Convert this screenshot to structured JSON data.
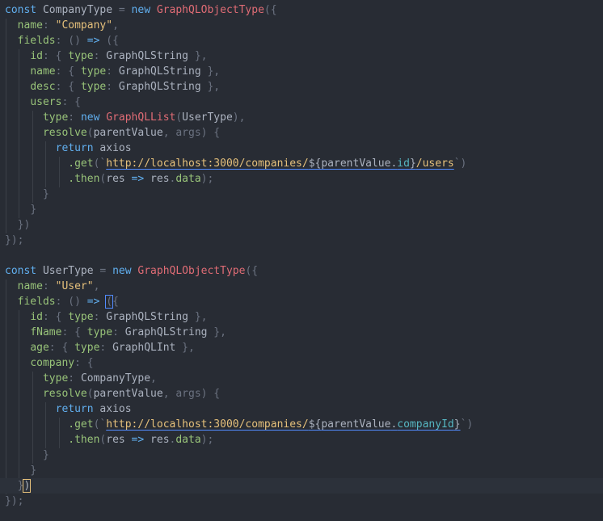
{
  "editor": {
    "lines": [
      [
        {
          "t": "const ",
          "c": "kw2"
        },
        {
          "t": "CompanyType",
          "c": "var"
        },
        {
          "t": " = ",
          "c": "punc"
        },
        {
          "t": "new ",
          "c": "kw2"
        },
        {
          "t": "GraphQLObjectType",
          "c": "class"
        },
        {
          "t": "({",
          "c": "punc"
        }
      ],
      [
        {
          "t": "  "
        },
        {
          "t": "name",
          "c": "prop"
        },
        {
          "t": ": ",
          "c": "punc"
        },
        {
          "t": "\"Company\"",
          "c": "str"
        },
        {
          "t": ",",
          "c": "punc"
        }
      ],
      [
        {
          "t": "  "
        },
        {
          "t": "fields",
          "c": "prop"
        },
        {
          "t": ": () ",
          "c": "punc"
        },
        {
          "t": "=>",
          "c": "kw2"
        },
        {
          "t": " ({",
          "c": "punc"
        }
      ],
      [
        {
          "t": "    "
        },
        {
          "t": "id",
          "c": "prop"
        },
        {
          "t": ": { ",
          "c": "punc"
        },
        {
          "t": "type",
          "c": "prop"
        },
        {
          "t": ": ",
          "c": "punc"
        },
        {
          "t": "GraphQLString",
          "c": "var"
        },
        {
          "t": " },",
          "c": "punc"
        }
      ],
      [
        {
          "t": "    "
        },
        {
          "t": "name",
          "c": "prop"
        },
        {
          "t": ": { ",
          "c": "punc"
        },
        {
          "t": "type",
          "c": "prop"
        },
        {
          "t": ": ",
          "c": "punc"
        },
        {
          "t": "GraphQLString",
          "c": "var"
        },
        {
          "t": " },",
          "c": "punc"
        }
      ],
      [
        {
          "t": "    "
        },
        {
          "t": "desc",
          "c": "prop"
        },
        {
          "t": ": { ",
          "c": "punc"
        },
        {
          "t": "type",
          "c": "prop"
        },
        {
          "t": ": ",
          "c": "punc"
        },
        {
          "t": "GraphQLString",
          "c": "var"
        },
        {
          "t": " },",
          "c": "punc"
        }
      ],
      [
        {
          "t": "    "
        },
        {
          "t": "users",
          "c": "prop"
        },
        {
          "t": ": {",
          "c": "punc"
        }
      ],
      [
        {
          "t": "      "
        },
        {
          "t": "type",
          "c": "prop"
        },
        {
          "t": ": ",
          "c": "punc"
        },
        {
          "t": "new ",
          "c": "kw2"
        },
        {
          "t": "GraphQLList",
          "c": "class"
        },
        {
          "t": "(",
          "c": "punc"
        },
        {
          "t": "UserType",
          "c": "var"
        },
        {
          "t": "),",
          "c": "punc"
        }
      ],
      [
        {
          "t": "      "
        },
        {
          "t": "resolve",
          "c": "fn"
        },
        {
          "t": "(",
          "c": "punc"
        },
        {
          "t": "parentValue",
          "c": "param"
        },
        {
          "t": ", ",
          "c": "punc"
        },
        {
          "t": "args",
          "c": "punc"
        },
        {
          "t": ") {",
          "c": "punc"
        }
      ],
      [
        {
          "t": "        "
        },
        {
          "t": "return ",
          "c": "kw2"
        },
        {
          "t": "axios",
          "c": "var"
        }
      ],
      [
        {
          "t": "          "
        },
        {
          "t": ".get",
          "c": "fn"
        },
        {
          "t": "(`",
          "c": "punc"
        },
        {
          "t": "http://localhost:3000/companies/",
          "c": "url"
        },
        {
          "t": "${",
          "c": "tmpl"
        },
        {
          "t": "parentValue",
          "c": "tmpl"
        },
        {
          "t": ".",
          "c": "tmpl"
        },
        {
          "t": "id",
          "c": "mem"
        },
        {
          "t": "}",
          "c": "tmpl"
        },
        {
          "t": "/users",
          "c": "url"
        },
        {
          "t": "`)",
          "c": "punc"
        }
      ],
      [
        {
          "t": "          "
        },
        {
          "t": ".then",
          "c": "fn"
        },
        {
          "t": "(",
          "c": "punc"
        },
        {
          "t": "res",
          "c": "param"
        },
        {
          "t": " => ",
          "c": "kw2"
        },
        {
          "t": "res",
          "c": "var"
        },
        {
          "t": ".",
          "c": "punc"
        },
        {
          "t": "data",
          "c": "prop"
        },
        {
          "t": ");",
          "c": "punc"
        }
      ],
      [
        {
          "t": "      "
        },
        {
          "t": "}",
          "c": "punc"
        }
      ],
      [
        {
          "t": "    "
        },
        {
          "t": "}",
          "c": "punc"
        }
      ],
      [
        {
          "t": "  "
        },
        {
          "t": "})",
          "c": "punc"
        }
      ],
      [
        {
          "t": "});",
          "c": "punc"
        }
      ],
      [],
      [
        {
          "t": "const ",
          "c": "kw2"
        },
        {
          "t": "UserType",
          "c": "var"
        },
        {
          "t": " = ",
          "c": "punc"
        },
        {
          "t": "new ",
          "c": "kw2"
        },
        {
          "t": "GraphQLObjectType",
          "c": "class"
        },
        {
          "t": "({",
          "c": "punc"
        }
      ],
      [
        {
          "t": "  "
        },
        {
          "t": "name",
          "c": "prop"
        },
        {
          "t": ": ",
          "c": "punc"
        },
        {
          "t": "\"User\"",
          "c": "str"
        },
        {
          "t": ",",
          "c": "punc"
        }
      ],
      [
        {
          "t": "  "
        },
        {
          "t": "fields",
          "c": "prop"
        },
        {
          "t": ": () ",
          "c": "punc"
        },
        {
          "t": "=>",
          "c": "kw2"
        },
        {
          "t": " ",
          "c": "punc"
        },
        {
          "t": "(",
          "c": "bm"
        },
        {
          "t": "{",
          "c": "punc"
        }
      ],
      [
        {
          "t": "    "
        },
        {
          "t": "id",
          "c": "prop"
        },
        {
          "t": ": { ",
          "c": "punc"
        },
        {
          "t": "type",
          "c": "prop"
        },
        {
          "t": ": ",
          "c": "punc"
        },
        {
          "t": "GraphQLString",
          "c": "var"
        },
        {
          "t": " },",
          "c": "punc"
        }
      ],
      [
        {
          "t": "    "
        },
        {
          "t": "fName",
          "c": "prop"
        },
        {
          "t": ": { ",
          "c": "punc"
        },
        {
          "t": "type",
          "c": "prop"
        },
        {
          "t": ": ",
          "c": "punc"
        },
        {
          "t": "GraphQLString",
          "c": "var"
        },
        {
          "t": " },",
          "c": "punc"
        }
      ],
      [
        {
          "t": "    "
        },
        {
          "t": "age",
          "c": "prop"
        },
        {
          "t": ": { ",
          "c": "punc"
        },
        {
          "t": "type",
          "c": "prop"
        },
        {
          "t": ": ",
          "c": "punc"
        },
        {
          "t": "GraphQLInt",
          "c": "var"
        },
        {
          "t": " },",
          "c": "punc"
        }
      ],
      [
        {
          "t": "    "
        },
        {
          "t": "company",
          "c": "prop"
        },
        {
          "t": ": {",
          "c": "punc"
        }
      ],
      [
        {
          "t": "      "
        },
        {
          "t": "type",
          "c": "prop"
        },
        {
          "t": ": ",
          "c": "punc"
        },
        {
          "t": "CompanyType",
          "c": "var"
        },
        {
          "t": ",",
          "c": "punc"
        }
      ],
      [
        {
          "t": "      "
        },
        {
          "t": "resolve",
          "c": "fn"
        },
        {
          "t": "(",
          "c": "punc"
        },
        {
          "t": "parentValue",
          "c": "param"
        },
        {
          "t": ", ",
          "c": "punc"
        },
        {
          "t": "args",
          "c": "punc"
        },
        {
          "t": ") {",
          "c": "punc"
        }
      ],
      [
        {
          "t": "        "
        },
        {
          "t": "return ",
          "c": "kw2"
        },
        {
          "t": "axios",
          "c": "var"
        }
      ],
      [
        {
          "t": "          "
        },
        {
          "t": ".get",
          "c": "fn"
        },
        {
          "t": "(`",
          "c": "punc"
        },
        {
          "t": "http://localhost:3000/companies/",
          "c": "url"
        },
        {
          "t": "${",
          "c": "tmpl"
        },
        {
          "t": "parentValue",
          "c": "tmpl"
        },
        {
          "t": ".",
          "c": "tmpl"
        },
        {
          "t": "companyId",
          "c": "mem"
        },
        {
          "t": "}",
          "c": "tmpl"
        },
        {
          "t": "`)",
          "c": "punc"
        }
      ],
      [
        {
          "t": "          "
        },
        {
          "t": ".then",
          "c": "fn"
        },
        {
          "t": "(",
          "c": "punc"
        },
        {
          "t": "res",
          "c": "param"
        },
        {
          "t": " => ",
          "c": "kw2"
        },
        {
          "t": "res",
          "c": "var"
        },
        {
          "t": ".",
          "c": "punc"
        },
        {
          "t": "data",
          "c": "prop"
        },
        {
          "t": ");",
          "c": "punc"
        }
      ],
      [
        {
          "t": "      "
        },
        {
          "t": "}",
          "c": "punc"
        }
      ],
      [
        {
          "t": "    "
        },
        {
          "t": "}",
          "c": "punc"
        }
      ],
      [
        {
          "t": "  "
        },
        {
          "t": "}",
          "c": "punc"
        },
        {
          "t": ")",
          "c": "cur"
        }
      ],
      [
        {
          "t": "});",
          "c": "punc"
        }
      ]
    ],
    "active_line": 31,
    "colors": {
      "background": "#282c34",
      "active_line": "#2c313a",
      "keyword": "#61afef",
      "class": "#e06c75",
      "string": "#e5c07b",
      "property": "#98c379"
    }
  }
}
